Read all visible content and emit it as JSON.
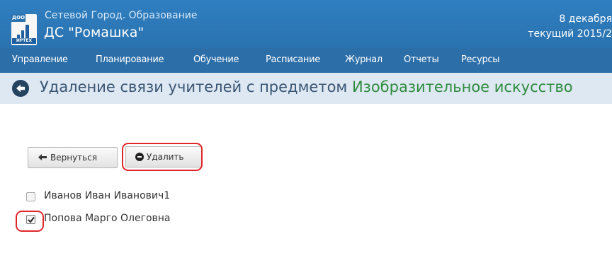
{
  "header": {
    "logo": {
      "top_text": "ДОО",
      "bottom_text": "ИРТЕХ"
    },
    "org_line": "Сетевой Город. Образование",
    "school_name": "ДС \"Ромашка\"",
    "date_line": "8 декабря",
    "year_line": "текущий 2015/2"
  },
  "nav": {
    "items": [
      "Управление",
      "Планирование",
      "Обучение",
      "Расписание",
      "Журнал",
      "Отчеты",
      "Ресурсы"
    ]
  },
  "title": {
    "prefix": "Удаление связи учителей с предметом",
    "subject": "Изобразительное искусство"
  },
  "buttons": {
    "back_label": "Вернуться",
    "delete_label": "Удалить"
  },
  "teachers": [
    {
      "name": "Иванов Иван Иванович1",
      "checked": false
    },
    {
      "name": "Попова Марго Олеговна",
      "checked": true
    }
  ],
  "colors": {
    "header_blue": "#2f7fc0",
    "nav_blue": "#2c6ea8",
    "title_bg": "#dde8f3",
    "subject_green": "#2e8b3d",
    "highlight_red": "#e0282b"
  },
  "icons": {
    "back_title": "arrow-left-circle-icon",
    "back_button": "arrow-left-icon",
    "delete_button": "minus-circle-icon",
    "check": "checkmark-icon"
  }
}
